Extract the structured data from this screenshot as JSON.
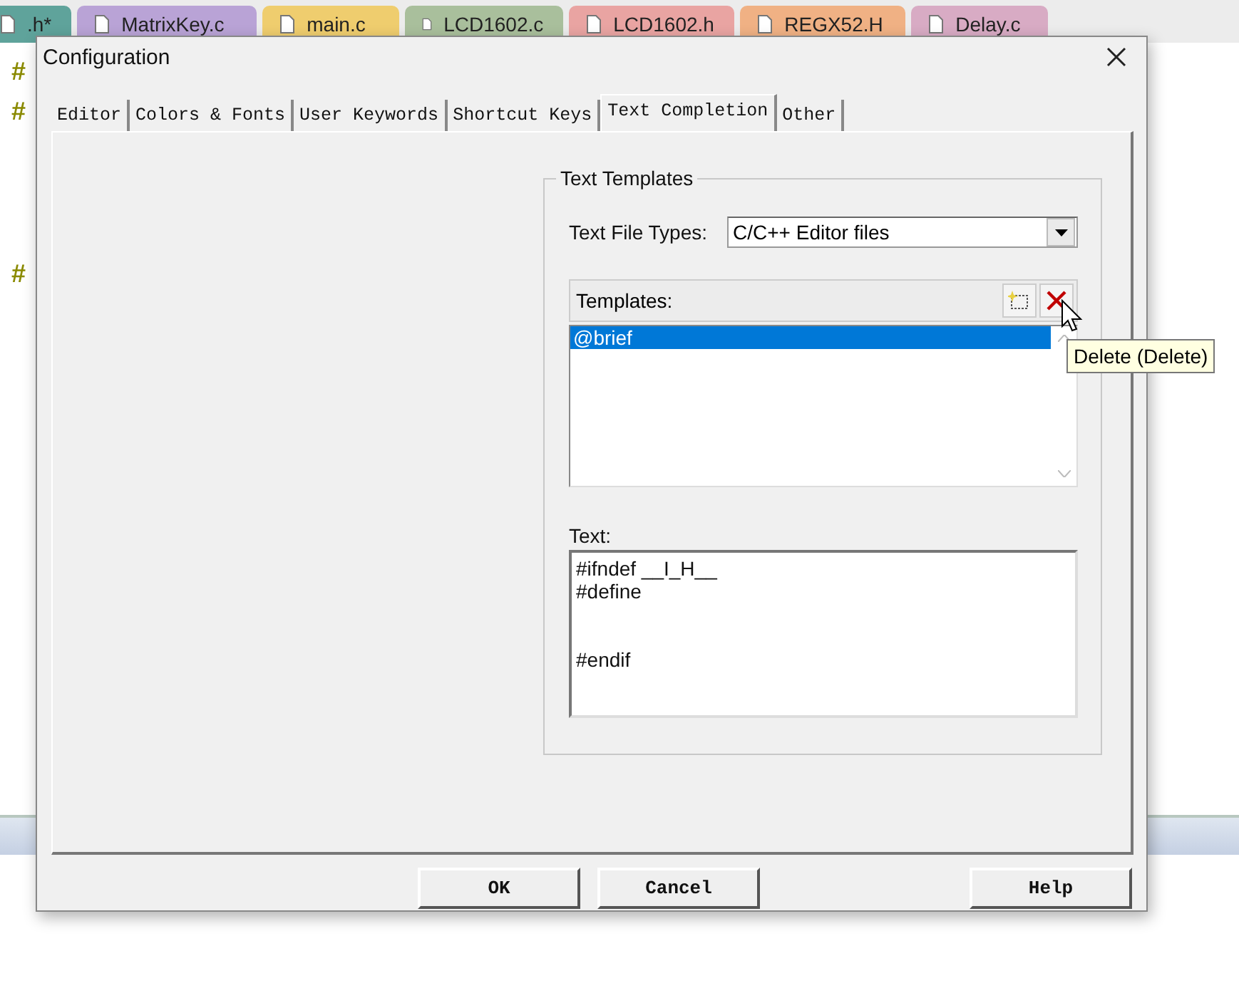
{
  "editor_tabs": [
    {
      "label": ".h*",
      "color": "#5fa39b"
    },
    {
      "label": "MatrixKey.c",
      "color": "#b9a3d6"
    },
    {
      "label": "main.c",
      "color": "#efcd6e"
    },
    {
      "label": "LCD1602.c",
      "color": "#a9bf9c"
    },
    {
      "label": "LCD1602.h",
      "color": "#e9a4a2"
    },
    {
      "label": "REGX52.H",
      "color": "#f0b184"
    },
    {
      "label": "Delay.c",
      "color": "#d8abc4"
    }
  ],
  "gutter": [
    "#",
    "#",
    "#"
  ],
  "dialog": {
    "title": "Configuration",
    "tabs": [
      {
        "label": "Editor",
        "selected": false
      },
      {
        "label": "Colors & Fonts",
        "selected": false
      },
      {
        "label": "User Keywords",
        "selected": false
      },
      {
        "label": "Shortcut Keys",
        "selected": false
      },
      {
        "label": "Text Completion",
        "selected": true
      },
      {
        "label": "Other",
        "selected": false
      }
    ],
    "group": {
      "title": "Text Templates",
      "file_types_label": "Text File Types:",
      "file_types_value": "C/C++ Editor files",
      "templates_label": "Templates:",
      "templates": [
        {
          "label": "@brief",
          "selected": true
        }
      ],
      "text_label": "Text:",
      "text_value": "#ifndef __I_H__\n#define\n\n\n#endif"
    },
    "tooltip": "Delete (Delete)",
    "buttons": [
      "OK",
      "Cancel",
      "Help"
    ]
  }
}
